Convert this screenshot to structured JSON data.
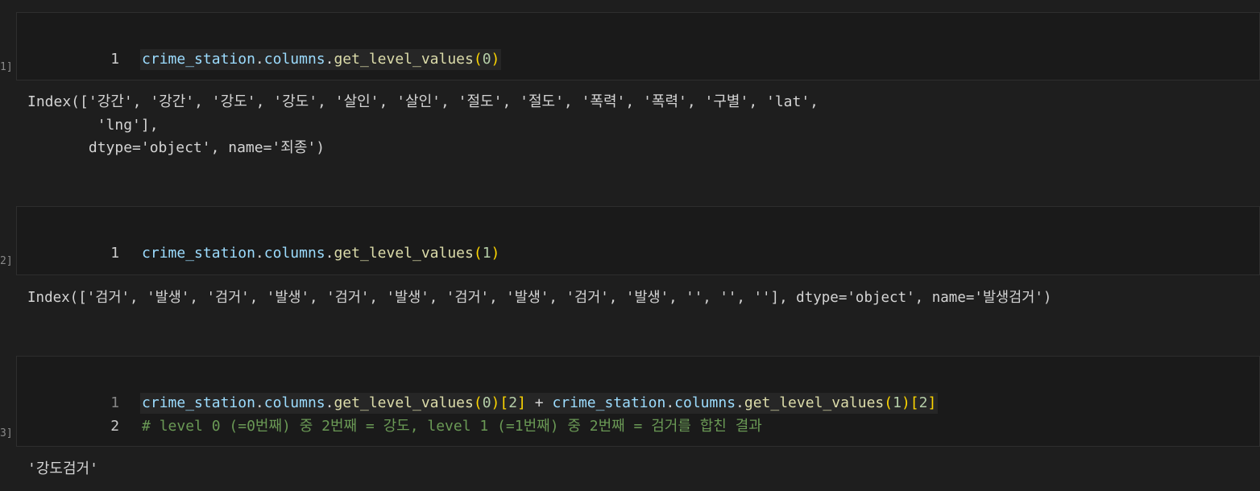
{
  "cells": [
    {
      "exec_count": "1]",
      "lines": [
        {
          "num": "1",
          "parts": [
            "crime_station",
            ".",
            "columns",
            ".",
            "get_level_values",
            "(",
            "0",
            ")"
          ]
        }
      ],
      "output": [
        "Index(['강간', '강간', '강도', '강도', '살인', '살인', '절도', '절도', '폭력', '폭력', '구별', 'lat',",
        "        'lng'],",
        "       dtype='object', name='죄종')"
      ]
    },
    {
      "exec_count": "2]",
      "lines": [
        {
          "num": "1",
          "parts": [
            "crime_station",
            ".",
            "columns",
            ".",
            "get_level_values",
            "(",
            "1",
            ")"
          ]
        }
      ],
      "output": [
        "Index(['검거', '발생', '검거', '발생', '검거', '발생', '검거', '발생', '검거', '발생', '', '', ''], dtype='object', name='발생검거')"
      ]
    },
    {
      "exec_count": "3]",
      "lines": [
        {
          "num": "1",
          "parts": [
            "crime_station",
            ".",
            "columns",
            ".",
            "get_level_values",
            "(",
            "0",
            ")",
            "[",
            "2",
            "]",
            " + ",
            "crime_station",
            ".",
            "columns",
            ".",
            "get_level_values",
            "(",
            "1",
            ")",
            "[",
            "2",
            "]"
          ]
        },
        {
          "num": "2",
          "comment": "# level 0 (=0번째) 중 2번째 = 강도, level 1 (=1번째) 중 2번째 = 검거를 합친 결과"
        }
      ],
      "output": [
        "'강도검거'"
      ]
    }
  ]
}
